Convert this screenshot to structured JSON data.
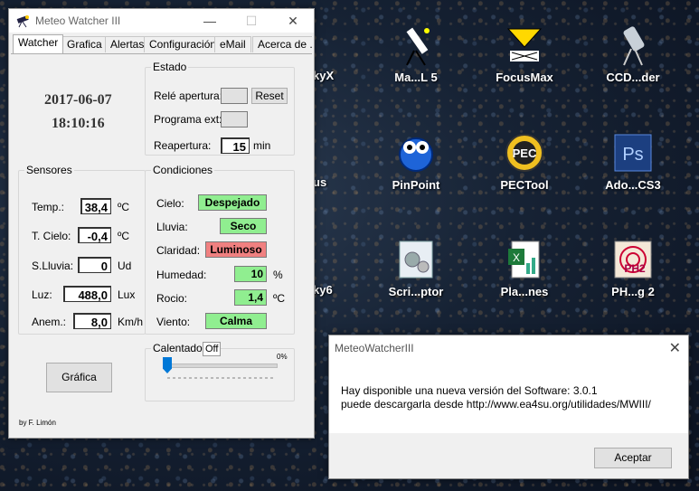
{
  "desktop": {
    "partial_labels": [
      "kyX",
      "us",
      "ky6"
    ],
    "icons": [
      {
        "label": "Ma...L 5",
        "icon": "telescope-icon"
      },
      {
        "label": "FocusMax",
        "icon": "focusmax-icon"
      },
      {
        "label": "CCD...der",
        "icon": "ccd-telescope-icon"
      },
      {
        "label": "PinPoint",
        "icon": "pinpoint-icon"
      },
      {
        "label": "PECTool",
        "icon": "pec-icon"
      },
      {
        "label": "Ado...CS3",
        "icon": "photoshop-icon"
      },
      {
        "label": "Scri...ptor",
        "icon": "script-gears-icon"
      },
      {
        "label": "Pla...nes",
        "icon": "excel-sheet-icon"
      },
      {
        "label": "PH...g 2",
        "icon": "phd2-icon"
      }
    ]
  },
  "window": {
    "title": "Meteo Watcher III",
    "tabs": [
      "Watcher",
      "Grafica",
      "Alertas",
      "Configuración",
      "eMail",
      "Acerca de ..."
    ],
    "date": "2017-06-07",
    "time": "18:10:16",
    "estado": {
      "title": "Estado",
      "rele_label": "Relé apertura:",
      "reset_label": "Reset",
      "programa_label": "Programa ext:",
      "reapertura_label": "Reapertura:",
      "reapertura_value": "15",
      "reapertura_unit": "min"
    },
    "sensores": {
      "title": "Sensores",
      "rows": [
        {
          "label": "Temp.:",
          "value": "38,4",
          "unit": "ºC"
        },
        {
          "label": "T. Cielo:",
          "value": "-0,4",
          "unit": "ºC"
        },
        {
          "label": "S.Lluvia:",
          "value": "0",
          "unit": "Ud"
        },
        {
          "label": "Luz:",
          "value": "488,0",
          "unit": "Lux"
        },
        {
          "label": "Anem.:",
          "value": "8,0",
          "unit": "Km/h"
        }
      ]
    },
    "condiciones": {
      "title": "Condiciones",
      "rows": [
        {
          "label": "Cielo:",
          "value": "Despejado",
          "color": "#90ee90"
        },
        {
          "label": "Lluvia:",
          "value": "Seco",
          "color": "#90ee90"
        },
        {
          "label": "Claridad:",
          "value": "Luminoso",
          "color": "#f08080"
        },
        {
          "label": "Humedad:",
          "value": "10",
          "unit": "%",
          "color": "#90ee90"
        },
        {
          "label": "Rocio:",
          "value": "1,4",
          "unit": "ºC",
          "color": "#90ee90"
        },
        {
          "label": "Viento:",
          "value": "Calma",
          "color": "#90ee90"
        }
      ]
    },
    "calentador": {
      "title": "Calentador",
      "state": "Off",
      "percent_label": "0%",
      "slider_value": 0
    },
    "grafica_button": "Gráfica",
    "credit": "by F. Limón"
  },
  "dialog": {
    "title": "MeteoWatcherIII",
    "line1": "Hay disponible una nueva versión del Software: 3.0.1",
    "line2": "puede descargarla desde http://www.ea4su.org/utilidades/MWIII/",
    "ok_label": "Aceptar"
  }
}
